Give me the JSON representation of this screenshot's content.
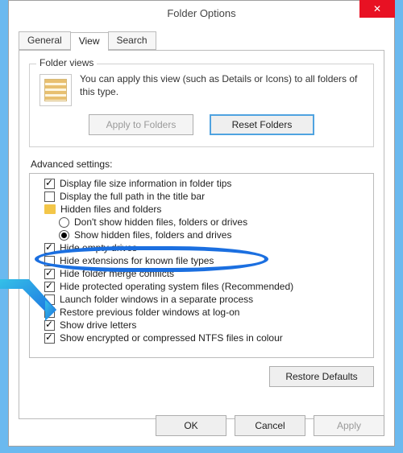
{
  "title": "Folder Options",
  "tabs": {
    "general": "General",
    "view": "View",
    "search": "Search"
  },
  "folder_views": {
    "legend": "Folder views",
    "desc": "You can apply this view (such as Details or Icons) to all folders of this type.",
    "apply": "Apply to Folders",
    "reset": "Reset Folders"
  },
  "advanced": {
    "label": "Advanced settings:",
    "items": [
      {
        "kind": "check",
        "checked": true,
        "label": "Display file size information in folder tips"
      },
      {
        "kind": "check",
        "checked": false,
        "label": "Display the full path in the title bar"
      },
      {
        "kind": "folder",
        "label": "Hidden files and folders"
      },
      {
        "kind": "radio",
        "checked": false,
        "nested": true,
        "label": "Don't show hidden files, folders or drives"
      },
      {
        "kind": "radio",
        "checked": true,
        "nested": true,
        "label": "Show hidden files, folders and drives"
      },
      {
        "kind": "check",
        "checked": true,
        "label": "Hide empty drives"
      },
      {
        "kind": "check",
        "checked": false,
        "label": "Hide extensions for known file types",
        "highlight": true
      },
      {
        "kind": "check",
        "checked": true,
        "label": "Hide folder merge conflicts"
      },
      {
        "kind": "check",
        "checked": true,
        "label": "Hide protected operating system files (Recommended)"
      },
      {
        "kind": "check",
        "checked": false,
        "label": "Launch folder windows in a separate process"
      },
      {
        "kind": "check",
        "checked": false,
        "label": "Restore previous folder windows at log-on"
      },
      {
        "kind": "check",
        "checked": true,
        "label": "Show drive letters"
      },
      {
        "kind": "check",
        "checked": true,
        "label": "Show encrypted or compressed NTFS files in colour"
      }
    ],
    "restore": "Restore Defaults"
  },
  "buttons": {
    "ok": "OK",
    "cancel": "Cancel",
    "apply": "Apply"
  }
}
